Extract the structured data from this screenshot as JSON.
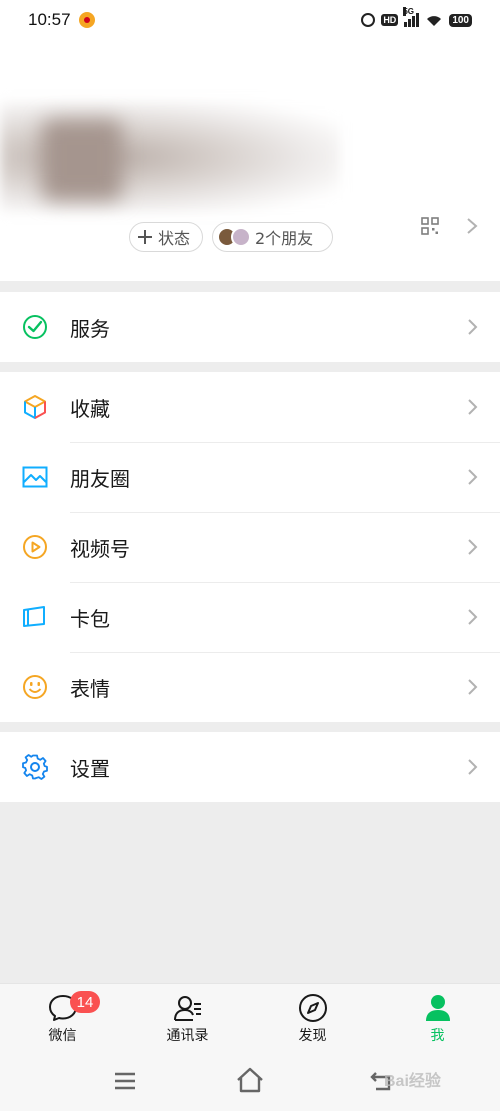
{
  "status_bar": {
    "time": "10:57",
    "signal_label": "5G",
    "hd_label": "HD",
    "battery": "100"
  },
  "profile": {
    "status_chip": "状态",
    "friends_chip": "2个朋友"
  },
  "menu_groups": [
    [
      {
        "label": "服务",
        "icon": "service-check-icon"
      }
    ],
    [
      {
        "label": "收藏",
        "icon": "favorites-cube-icon"
      },
      {
        "label": "朋友圈",
        "icon": "moments-picture-icon"
      },
      {
        "label": "视频号",
        "icon": "channels-play-icon"
      },
      {
        "label": "卡包",
        "icon": "card-wallet-icon"
      },
      {
        "label": "表情",
        "icon": "sticker-smile-icon"
      }
    ],
    [
      {
        "label": "设置",
        "icon": "settings-gear-icon"
      }
    ]
  ],
  "tabbar": {
    "tabs": [
      {
        "label": "微信",
        "icon": "chat-bubble-icon",
        "badge": "14"
      },
      {
        "label": "通讯录",
        "icon": "contacts-icon"
      },
      {
        "label": "发现",
        "icon": "compass-icon"
      },
      {
        "label": "我",
        "icon": "person-icon",
        "active": true
      }
    ]
  },
  "watermark": "Bai经验",
  "colors": {
    "accent_green": "#07c160",
    "badge_red": "#fa5151",
    "background": "#ededed"
  }
}
